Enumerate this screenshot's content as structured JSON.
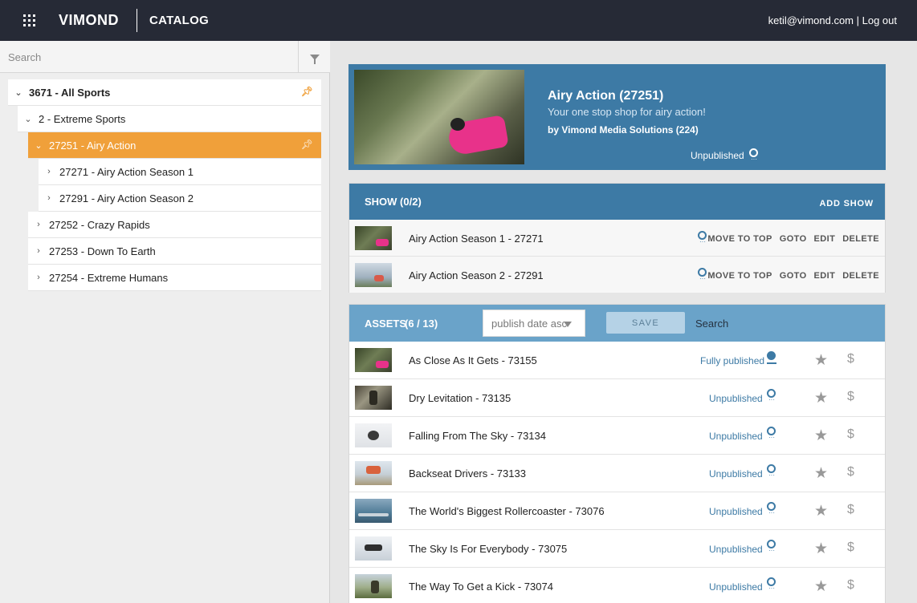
{
  "topbar": {
    "logo": "VIMOND",
    "app_name": "CATALOG",
    "user_email": "ketil@vimond.com",
    "separator": " | ",
    "logout": "Log out"
  },
  "sidebar": {
    "search_placeholder": "Search",
    "tree": [
      {
        "label": "3671 - All Sports",
        "chevron": "⌄",
        "pinned": true
      },
      {
        "label": "2 - Extreme Sports",
        "chevron": "⌄",
        "pinned": false
      },
      {
        "label": "27251 - Airy Action",
        "chevron": "⌄",
        "pinned": true,
        "active": true
      },
      {
        "label": "27271 - Airy Action Season 1",
        "chevron": "›",
        "pinned": false
      },
      {
        "label": "27291 - Airy Action Season 2",
        "chevron": "›",
        "pinned": false
      },
      {
        "label": "27252 - Crazy Rapids",
        "chevron": "›",
        "pinned": false
      },
      {
        "label": "27253 - Down To Earth",
        "chevron": "›",
        "pinned": false
      },
      {
        "label": "27254 - Extreme Humans",
        "chevron": "›",
        "pinned": false
      }
    ]
  },
  "header": {
    "title": "Airy Action (27251)",
    "description": "Your one stop shop for airy action!",
    "by": "by Vimond Media Solutions (224)",
    "status": "Unpublished"
  },
  "show": {
    "title": "SHOW (0/2)",
    "add_label": "ADD SHOW",
    "actions": {
      "move_to_top": "MOVE TO TOP",
      "goto": "GOTO",
      "edit": "EDIT",
      "delete": "DELETE"
    },
    "rows": [
      {
        "name": "Airy Action Season 1 - 27271"
      },
      {
        "name": "Airy Action Season 2 - 27291"
      }
    ]
  },
  "assets": {
    "title": "ASSETS",
    "count": "(6 / 13)",
    "sort_value": "publish date asc",
    "save_label": "SAVE",
    "search_label": "Search",
    "rows": [
      {
        "name": "As Close As It Gets - 73155",
        "status": "Fully published"
      },
      {
        "name": "Dry Levitation - 73135",
        "status": "Unpublished"
      },
      {
        "name": "Falling From The Sky - 73134",
        "status": "Unpublished"
      },
      {
        "name": "Backseat Drivers - 73133",
        "status": "Unpublished"
      },
      {
        "name": "The World's Biggest Rollercoaster - 73076",
        "status": "Unpublished"
      },
      {
        "name": "The Sky Is For Everybody - 73075",
        "status": "Unpublished"
      },
      {
        "name": "The Way To Get a Kick - 73074",
        "status": "Unpublished"
      }
    ]
  },
  "icons": {
    "apps": "grid-icon",
    "filter": "filter-icon",
    "pin": "pin-icon",
    "star": "★",
    "dollar": "$",
    "ring_dots": "···"
  },
  "colors": {
    "topbar": "#262a36",
    "accent_orange": "#f0a03a",
    "panel_blue": "#3d7aa5",
    "assets_blue": "#6aa3c9"
  }
}
